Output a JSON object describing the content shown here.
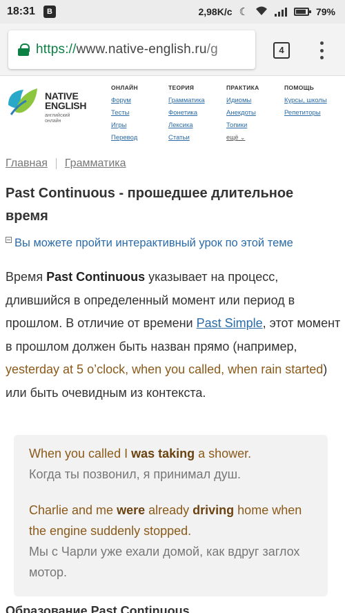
{
  "status": {
    "time": "18:31",
    "app_badge": "B",
    "speed": "2,98K/c",
    "battery": "79%"
  },
  "browser": {
    "url_scheme": "https://",
    "url_host": "www.native-english.ru",
    "url_rest": "/g",
    "tab_count": "4"
  },
  "logo": {
    "title_line1": "NATIVE",
    "title_line2": "ENGLISH",
    "sub_line1": "английский",
    "sub_line2": "онлайн"
  },
  "nav": [
    {
      "head": "ОНЛАЙН",
      "links": [
        "Форум",
        "Тесты",
        "Игры",
        "Перевод"
      ]
    },
    {
      "head": "ТЕОРИЯ",
      "links": [
        "Грамматика",
        "Фонетика",
        "Лексика",
        "Статьи"
      ]
    },
    {
      "head": "ПРАКТИКА",
      "links": [
        "Идиомы",
        "Анекдоты",
        "Топики",
        "ещё ⌄"
      ]
    },
    {
      "head": "ПОМОЩЬ",
      "links": [
        "Курсы, школы",
        "Репетиторы"
      ]
    }
  ],
  "breadcrumb": {
    "home": "Главная",
    "section": "Грамматика"
  },
  "title": "Past Continuous - прошедшее длительное время",
  "lesson_link": "Вы можете пройти интерактивный урок по этой теме",
  "intro": {
    "p1": "Время ",
    "term": "Past Continuous",
    "p2": " указывает на процесс, длившийся в определенный момент или период в прошлом. В отличие от времени ",
    "link": "Past Simple",
    "p3": ", этот момент в прошлом должен быть назван прямо (например, ",
    "examples": "yesterday at 5 o’clock, when you called, when rain started",
    "p4": ") или быть очевидным из контекста."
  },
  "examples": [
    {
      "en_a": "When you called I ",
      "en_b1": "was taking",
      "en_c": " a shower.",
      "ru": "Когда ты позвонил, я принимал душ."
    },
    {
      "en_a": "Charlie and me ",
      "en_b1": "were",
      "en_mid": " already ",
      "en_b2": "driving",
      "en_c": " home when the engine suddenly stopped.",
      "ru": "Мы с Чарли уже ехали домой, как вдруг заглох мотор."
    }
  ],
  "cutoff_heading": "Образование Past Continuous"
}
